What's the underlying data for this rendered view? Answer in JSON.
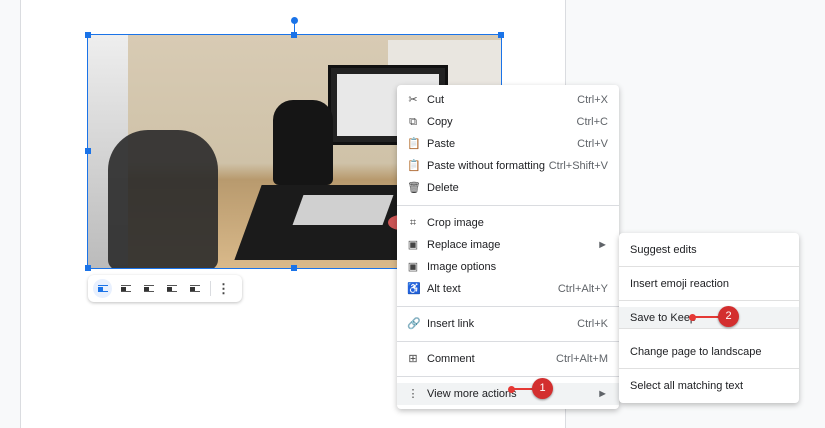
{
  "context_menu": {
    "items": [
      {
        "icon": "✂",
        "label": "Cut",
        "shortcut": "Ctrl+X"
      },
      {
        "icon": "⧉",
        "label": "Copy",
        "shortcut": "Ctrl+C"
      },
      {
        "icon": "📋",
        "label": "Paste",
        "shortcut": "Ctrl+V"
      },
      {
        "icon": "📋",
        "label": "Paste without formatting",
        "shortcut": "Ctrl+Shift+V"
      },
      {
        "icon": "🗑",
        "label": "Delete",
        "shortcut": ""
      },
      {
        "icon": "⌗",
        "label": "Crop image",
        "shortcut": ""
      },
      {
        "icon": "▣",
        "label": "Replace image",
        "shortcut": "►"
      },
      {
        "icon": "▣",
        "label": "Image options",
        "shortcut": ""
      },
      {
        "icon": "♿",
        "label": "Alt text",
        "shortcut": "Ctrl+Alt+Y"
      },
      {
        "icon": "🔗",
        "label": "Insert link",
        "shortcut": "Ctrl+K"
      },
      {
        "icon": "⊞",
        "label": "Comment",
        "shortcut": "Ctrl+Alt+M"
      },
      {
        "icon": "⋮",
        "label": "View more actions",
        "shortcut": "►"
      }
    ]
  },
  "submenu": {
    "items": [
      "Suggest edits",
      "Insert emoji reaction",
      "Save to Keep",
      "Change page to landscape",
      "Select all matching text"
    ]
  },
  "image_toolbar": {
    "more": "⋮"
  },
  "annotations": [
    "1",
    "2"
  ],
  "colors": {
    "accent": "#1a73e8",
    "annotation": "#d32f2f"
  }
}
